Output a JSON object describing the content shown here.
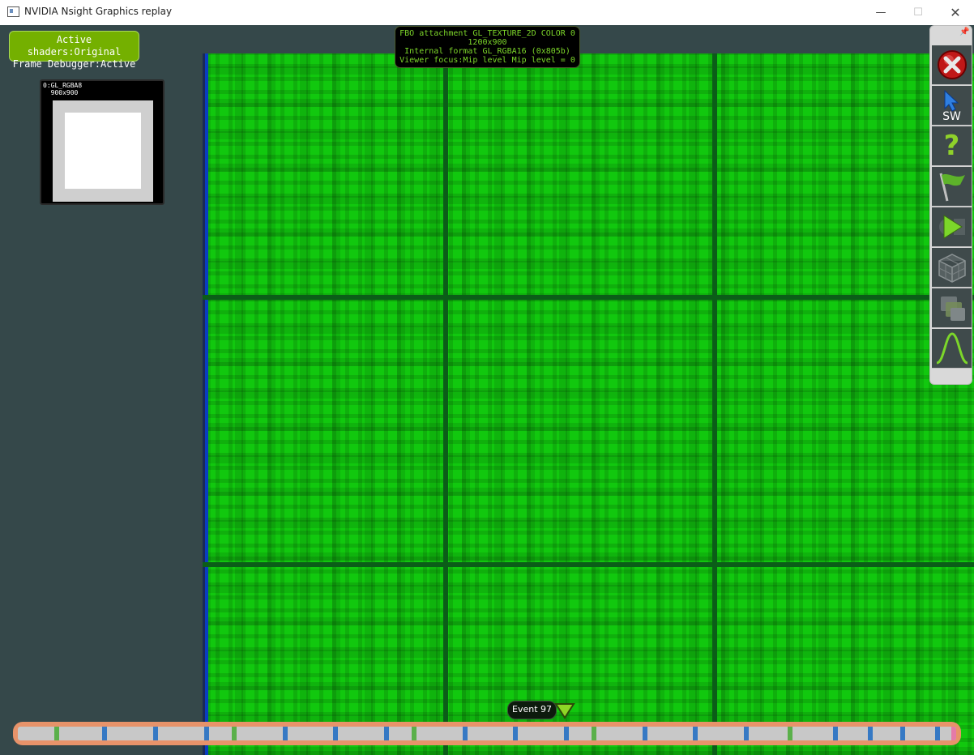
{
  "window": {
    "title": "NVIDIA Nsight Graphics replay",
    "icon": "app-window-icon",
    "controls": [
      "minimize-icon",
      "maximize-icon",
      "close-icon"
    ]
  },
  "status": {
    "line1": "Active shaders:Original",
    "line2": "Frame Debugger:Active",
    "color": "#74b000"
  },
  "thumbnail": {
    "label_line1": "0:GL_RGBA8",
    "label_line2": "900x900"
  },
  "viewer_info": {
    "line1": "FBO attachment GL_TEXTURE_2D COLOR 0",
    "line2": "1200x900",
    "line3": "Internal format GL_RGBA16 (0x805b)",
    "line4": "Viewer focus:Mip level Mip level = 0",
    "text_color": "#7cd62a",
    "texture_color": "#11c80e"
  },
  "toolbar": {
    "pin_icon": "pin-icon",
    "buttons": [
      {
        "name": "close-hud-button",
        "icon": "red-x-close-icon"
      },
      {
        "name": "select-sw-button",
        "icon": "cursor-sw-icon",
        "label": "SW"
      },
      {
        "name": "help-button",
        "icon": "question-mark-icon",
        "label": "?"
      },
      {
        "name": "flag-button",
        "icon": "green-flag-icon"
      },
      {
        "name": "play-button",
        "icon": "play-icon"
      },
      {
        "name": "geometry-button",
        "icon": "wireframe-cube-icon"
      },
      {
        "name": "layers-button",
        "icon": "stacked-layers-icon"
      },
      {
        "name": "profiler-button",
        "icon": "bell-curve-icon"
      }
    ]
  },
  "event": {
    "label": "Event 97",
    "marker_icon": "triangle-down-marker-icon"
  },
  "timeline": {
    "accent": "#e7936a",
    "tick_colors": {
      "draw": "#3579c4",
      "marker": "#5ab04a",
      "end": "#e57aa8"
    }
  }
}
